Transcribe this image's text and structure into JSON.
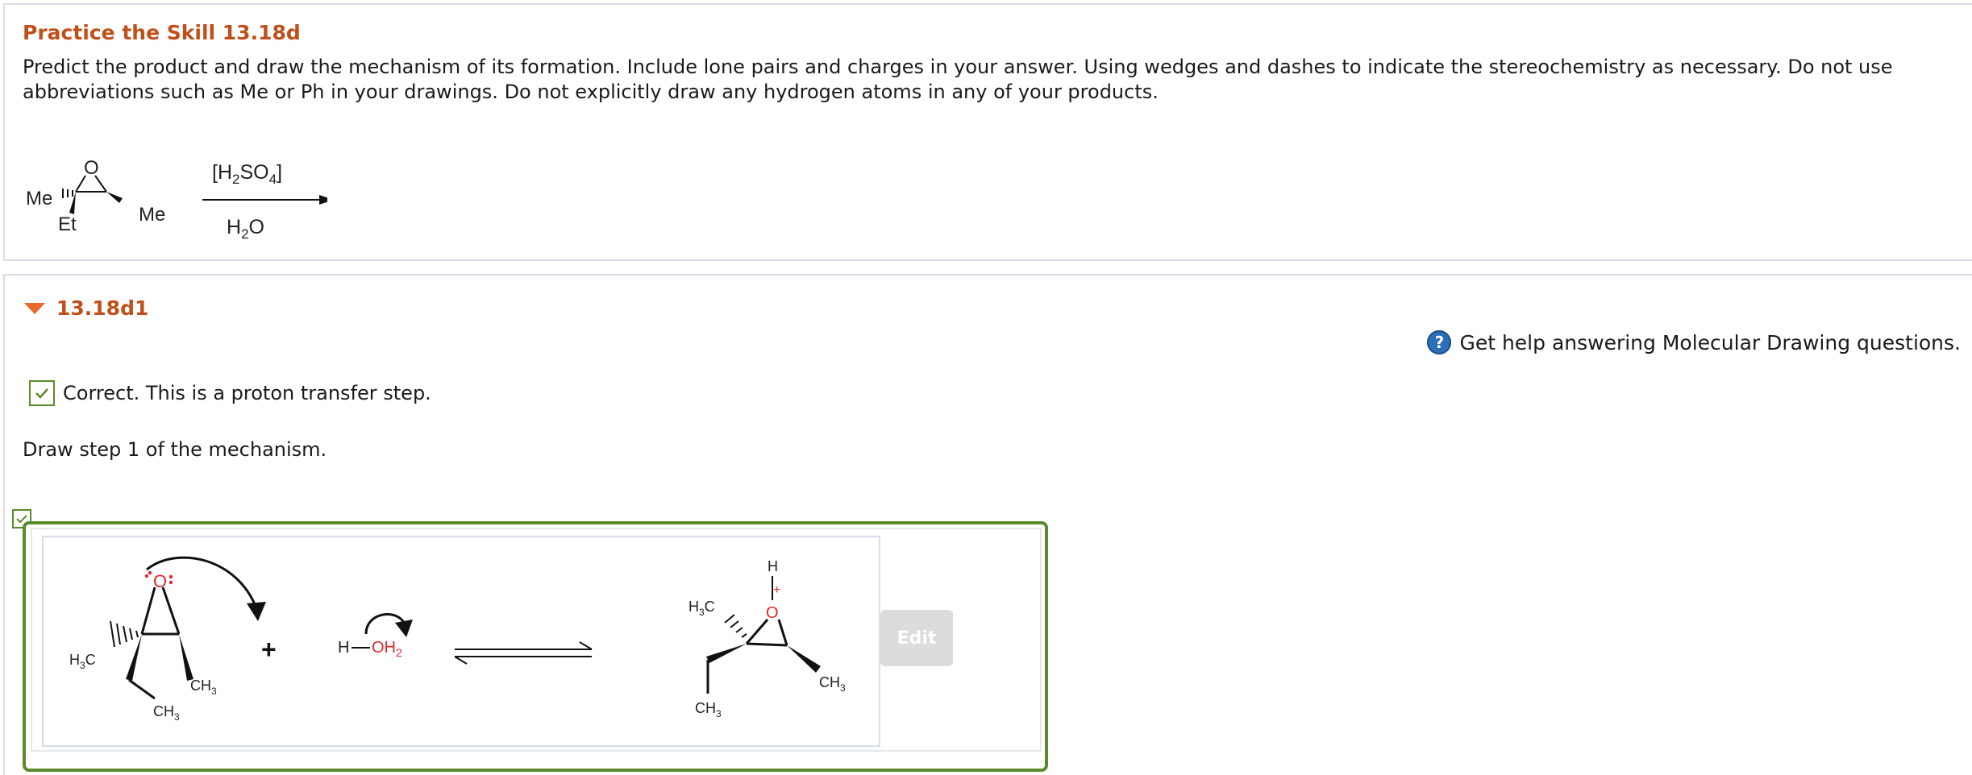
{
  "problem": {
    "title": "Practice the Skill 13.18d",
    "description": "Predict the product and draw the mechanism of its formation. Include lone pairs and charges in your answer. Using wedges and dashes to indicate the stereochemistry as necessary. Do not use abbreviations such as Me or Ph in your drawings. Do not explicitly draw any hydrogen atoms in any of your products.",
    "scheme": {
      "reagent_above": "[H2SO4]",
      "reagent_below": "H2O",
      "atoms": {
        "oxygen": "O",
        "left_dash": "Me",
        "left_wedge": "Et",
        "right_wedge": "Me"
      }
    }
  },
  "part": {
    "label": "13.18d1",
    "help_text": "Get help answering Molecular Drawing questions.",
    "help_icon": "question-circle-icon",
    "feedback": "Correct. This is a proton transfer step.",
    "instruction": "Draw step 1 of the mechanism.",
    "edit_label": "Edit",
    "colors": {
      "accent": "#c0501a",
      "correct": "#5a8a2a",
      "oxygen": "#e0282e",
      "help": "#2a6fb8"
    },
    "mechanism": {
      "plus": "+",
      "reactant": {
        "O": "O",
        "H3C": "H3C",
        "CH3_a": "CH3",
        "CH3_b": "CH3"
      },
      "water": {
        "H": "H",
        "OH2": "OH2"
      },
      "product": {
        "H": "H",
        "O": "O",
        "charge": "+",
        "H3C": "H3C",
        "CH3_a": "CH3",
        "CH3_b": "CH3"
      }
    }
  }
}
